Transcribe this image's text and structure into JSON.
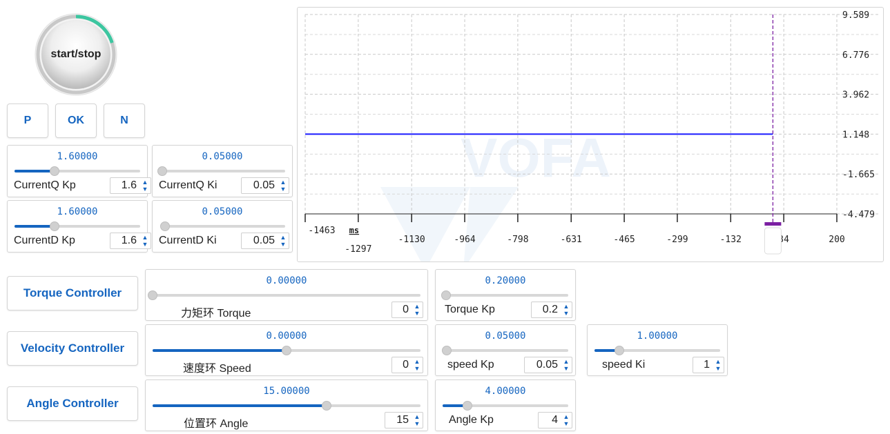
{
  "start_stop": {
    "label": "start/stop",
    "progress": 0.2
  },
  "nav": {
    "prev": "P",
    "ok": "OK",
    "next": "N"
  },
  "sliders": {
    "currentq_kp": {
      "value_text": "1.60000",
      "label": "CurrentQ Kp",
      "spin": "1.6",
      "fraction": 0.32
    },
    "currentq_ki": {
      "value_text": "0.05000",
      "label": "CurrentQ Ki",
      "spin": "0.05",
      "fraction": 0.0
    },
    "currentd_kp": {
      "value_text": "1.60000",
      "label": "CurrentD Kp",
      "spin": "1.6",
      "fraction": 0.32
    },
    "currentd_ki": {
      "value_text": "0.05000",
      "label": "CurrentD Ki",
      "spin": "0.05",
      "fraction": 0.02
    },
    "torque": {
      "value_text": "0.00000",
      "label": "力矩环 Torque",
      "spin": "0",
      "fraction": 0.0
    },
    "torque_kp": {
      "value_text": "0.20000",
      "label": "Torque Kp",
      "spin": "0.2",
      "fraction": 0.03
    },
    "speed": {
      "value_text": "0.00000",
      "label": "速度环 Speed",
      "spin": "0",
      "fraction": 0.5
    },
    "speed_kp": {
      "value_text": "0.05000",
      "label": "speed Kp",
      "spin": "0.05",
      "fraction": 0.02
    },
    "speed_ki": {
      "value_text": "1.00000",
      "label": "speed Ki",
      "spin": "1",
      "fraction": 0.2
    },
    "angle": {
      "value_text": "15.00000",
      "label": "位置环 Angle",
      "spin": "15",
      "fraction": 0.65
    },
    "angle_kp": {
      "value_text": "4.00000",
      "label": "Angle Kp",
      "spin": "4",
      "fraction": 0.2
    }
  },
  "controllers": {
    "torque": "Torque Controller",
    "velocity": "Velocity Controller",
    "angle": "Angle Controller"
  },
  "chart_data": {
    "type": "line",
    "x_unit": "ms",
    "x_ticks": [
      "-1463",
      "-1297",
      "-1130",
      "-964",
      "-798",
      "-631",
      "-465",
      "-299",
      "-132",
      "0",
      "34",
      "200"
    ],
    "y_ticks": [
      "9.589",
      "6.776",
      "3.962",
      "1.148",
      "-1.665",
      "-4.479"
    ],
    "xlim": [
      -1463,
      200
    ],
    "ylim": [
      -4.479,
      9.589
    ],
    "cursor_x": 0,
    "grid": true,
    "series": [
      {
        "color": "#1a1aff",
        "x": [
          -1463,
          0
        ],
        "y": [
          1.148,
          1.148
        ]
      }
    ]
  },
  "colors": {
    "accent": "#1565c0",
    "ring": "#3cc6a0",
    "cursor": "#7b1fa2"
  }
}
